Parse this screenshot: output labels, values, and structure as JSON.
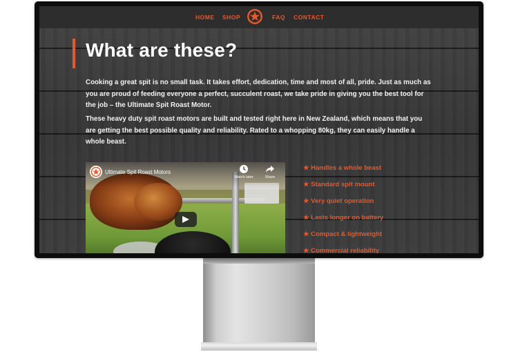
{
  "nav": {
    "items": [
      "HOME",
      "SHOP",
      "FAQ",
      "CONTACT"
    ],
    "logo_icon": "star-badge-logo-icon"
  },
  "hero": {
    "heading": "What are these?",
    "paragraphs": [
      "Cooking a great spit is no small task. It takes effort, dedication, time and most of all, pride. Just as much as you are proud of feeding everyone a perfect, succulent roast, we take pride in giving you the best tool for the job – the Ultimate Spit Roast Motor.",
      "These heavy duty spit roast motors are built and tested right here in New Zealand, which means that you are getting the best possible quality and reliability. Rated to a whopping 80kg, they can easily handle a whole beast."
    ]
  },
  "video": {
    "title": "Ultimate Spit Roast Motors",
    "watch_later": "Watch later",
    "share": "Share",
    "play_icon": "play-icon"
  },
  "features": [
    "★ Handles a whole beast",
    "★ Standard spit mount",
    "★ Very quiet operation",
    "★ Lasts longer on battery",
    "★ Compact & lightweight",
    "★ Commercial reliability"
  ],
  "colors": {
    "accent": "#e8582a",
    "background": "#3a3a3a",
    "nav_background": "#2d2d2d",
    "text": "#ffffff"
  }
}
